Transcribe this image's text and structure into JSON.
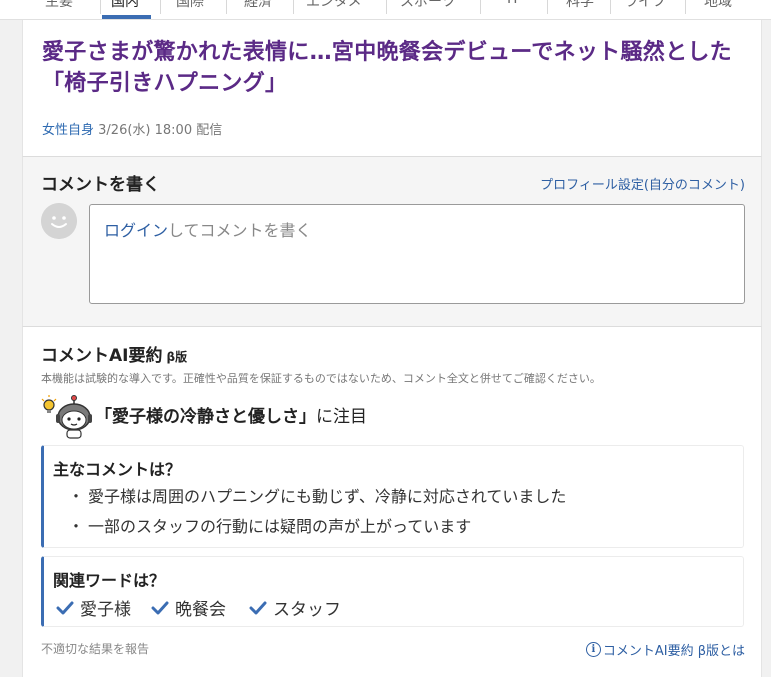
{
  "nav": {
    "tabs": [
      "主要",
      "国内",
      "国際",
      "経済",
      "エンタメ",
      "スポーツ",
      "IT",
      "科学",
      "ライフ",
      "地域"
    ],
    "active_index": 1
  },
  "article": {
    "headline": "愛子さまが驚かれた表情に…宮中晩餐会デビューでネット騒然とした「椅子引きハプニング」",
    "source": "女性自身",
    "datetime": "3/26(水) 18:00",
    "delivered_label": "配信"
  },
  "comment_box": {
    "title": "コメントを書く",
    "profile_link": "プロフィール設定(自分のコメント)",
    "login_link": "ログイン",
    "placeholder_rest": "してコメントを書く"
  },
  "ai_summary": {
    "title": "コメントAI要約",
    "beta": "β版",
    "disclaimer": "本機能は試験的な導入です。正確性や品質を保証するものではないため、コメント全文と併せてご確認ください。",
    "focus_topic": "「愛子様の冷静さと優しさ」",
    "focus_suffix": "に注目",
    "main_heading": "主なコメントは？",
    "main_comments": [
      "愛子様は周囲のハプニングにも動じず、冷静に対応されていました",
      "一部のスタッフの行動には疑問の声が上がっています"
    ],
    "words_heading": "関連ワードは？",
    "words": [
      "愛子様",
      "晩餐会",
      "スタッフ"
    ],
    "report_link": "不適切な結果を報告",
    "about_link": "コメントAI要約 β版とは",
    "accent_color": "#3b6db3",
    "title_color": "#5b2a86"
  }
}
